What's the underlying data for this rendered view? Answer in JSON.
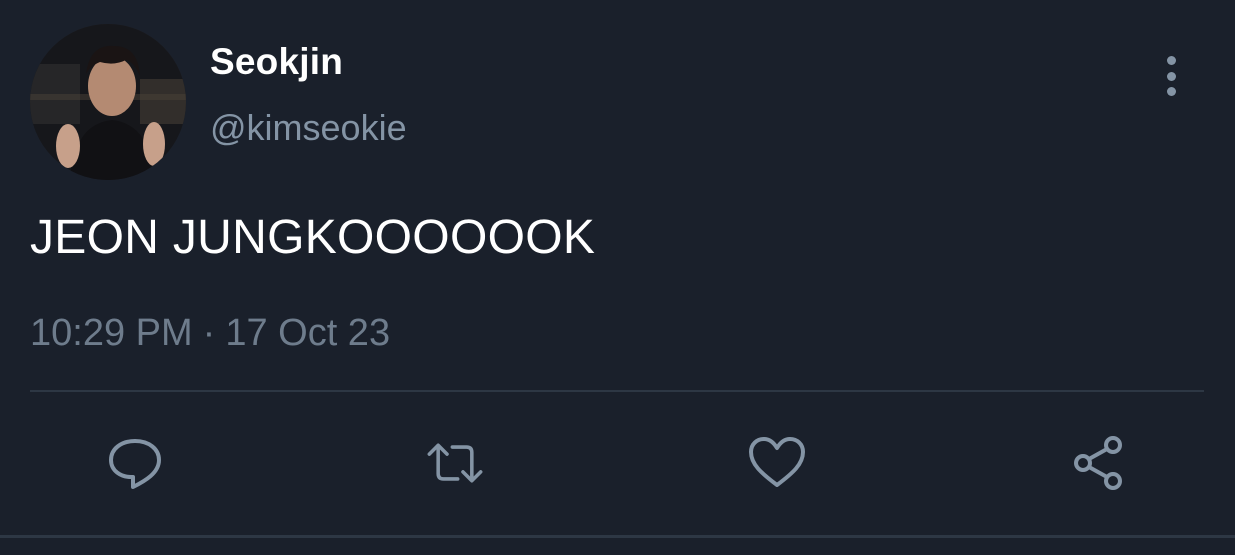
{
  "tweet": {
    "author": {
      "display_name": "Seokjin",
      "handle": "@kimseokie"
    },
    "text": "JEON JUNGKOOOOOOK",
    "time": "10:29 PM",
    "separator": "·",
    "date": "17 Oct 23"
  },
  "actions": [
    {
      "name": "reply",
      "icon": "comment-icon"
    },
    {
      "name": "retweet",
      "icon": "retweet-icon"
    },
    {
      "name": "like",
      "icon": "heart-icon"
    },
    {
      "name": "share",
      "icon": "share-icon"
    }
  ],
  "colors": {
    "background": "#1a202b",
    "primary_text": "#ffffff",
    "secondary_text": "#8494a5",
    "divider": "#2d3744"
  }
}
